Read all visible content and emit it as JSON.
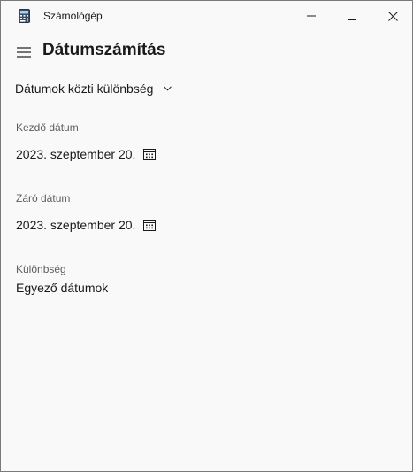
{
  "window": {
    "title": "Számológép"
  },
  "header": {
    "title": "Dátumszámítás"
  },
  "mode": {
    "selected": "Dátumok közti különbség"
  },
  "start": {
    "label": "Kezdő dátum",
    "value": "2023. szeptember 20."
  },
  "end": {
    "label": "Záró dátum",
    "value": "2023. szeptember 20."
  },
  "result": {
    "label": "Különbség",
    "value": "Egyező dátumok"
  },
  "icons": {
    "app": "calculator-icon",
    "menu": "hamburger-icon",
    "dropdown": "chevron-down-icon",
    "calendar": "calendar-icon",
    "minimize": "minimize-icon",
    "maximize": "maximize-icon",
    "close": "close-icon"
  },
  "colors": {
    "background": "#f9f9f9",
    "text": "#1a1a1a",
    "label": "#5e5e5e",
    "border": "#7a7a7a"
  }
}
